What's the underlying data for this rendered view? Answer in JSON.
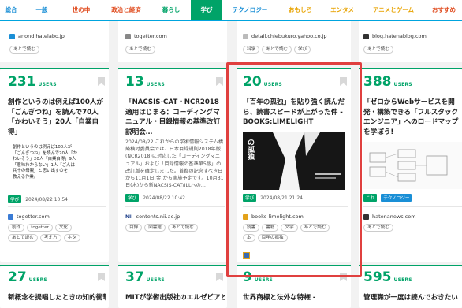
{
  "nav": [
    {
      "label": "総合",
      "color": "#1a8fd6"
    },
    {
      "label": "一般",
      "color": "#1a8fd6"
    },
    {
      "label": "世の中",
      "color": "#e04c1f"
    },
    {
      "label": "政治と経済",
      "color": "#e04c1f"
    },
    {
      "label": "暮らし",
      "color": "#00a368"
    },
    {
      "label": "学び",
      "color": "#ffffff",
      "active": true
    },
    {
      "label": "テクノロジー",
      "color": "#1a8fd6"
    },
    {
      "label": "おもしろ",
      "color": "#e8a300"
    },
    {
      "label": "エンタメ",
      "color": "#e8a300"
    },
    {
      "label": "アニメとゲーム",
      "color": "#e8a300"
    },
    {
      "label": "おすすめ",
      "color": "#e04c1f"
    }
  ],
  "top_strip": [
    {
      "source": "anond.hatelabo.jp",
      "tags": [
        "あとで読む"
      ]
    },
    {
      "source": "togetter.com",
      "tags": [
        "あとで読む"
      ]
    },
    {
      "source": "detail.chiebukuro.yahoo.co.jp",
      "tags": [
        "科学",
        "あとで読む",
        "学び"
      ]
    },
    {
      "source": "blog.hatenablog.com",
      "tags": [
        "あとで読む"
      ]
    }
  ],
  "cards": [
    {
      "users": "231",
      "users_label": "USERS",
      "title": "創作というのは例えば100人が「ごんぎつね」を読んで70人「かわいそう」20人「自業自得」",
      "thumb_lines": [
        "創作というのは例えば100人が",
        "「ごんぎつね」を読んで70人「か",
        "わいそう」20人「自業自得」9人",
        "「意味わからない」1人「ごんは",
        "兵十の母親」と思い出すのを",
        "教える作業。"
      ],
      "category": "学び",
      "date": "2024/08/22 10:54",
      "source": "togetter.com",
      "tags": [
        "創作",
        "togetter",
        "文化",
        "あとで読む",
        "考え方",
        "ネタ"
      ]
    },
    {
      "users": "13",
      "users_label": "USERS",
      "title": "「NACSIS-CAT・NCR2018適用はじまる：コーディングマニュアル・目録情報の基準改訂説明会…",
      "desc": "2024/08/22 これからの学術情報システム構築検討委員会では、日本目録規則2018年版(NCR2018)に対応した「コーディングマニュアル」および「目録情報の基準第5版」の改訂版を確定しました。首都の記念すべき日から11月1日(金)から実施予定です。10月31日(木)から新NACSIS-CAT/ILLへの…",
      "category": "学び",
      "date": "2024/08/22 10:42",
      "source": "contents.nii.ac.jp",
      "tags": [
        "目録",
        "図書館",
        "あとで読む"
      ]
    },
    {
      "users": "20",
      "users_label": "USERS",
      "title": "「百年の孤独」を貼り強く読んだら、読書スピードが上がった件 - BOOKS:LIMELIGHT",
      "thumb_text": "の孤独",
      "category": "学び",
      "date": "2024/08/21 21:24",
      "source": "books-limelight.com",
      "tags": [
        "読書",
        "書籍",
        "文学",
        "あとで読む",
        "本",
        "百年の孤独"
      ]
    },
    {
      "users": "388",
      "users_label": "USERS",
      "title": "「ゼロからWebサービスを開発・構築できる「フルスタックエンジニア」へのロードマップを学ぼう!",
      "category": "これ",
      "category2": "テクノロジー",
      "source": "hatenanews.com",
      "tags": [
        "あとで読む"
      ]
    }
  ],
  "bottom_cards": [
    {
      "users": "27",
      "users_label": "USERS",
      "title": "新概念を提唱したときの知的衝撃"
    },
    {
      "users": "37",
      "users_label": "USERS",
      "title": "MITが学術出版社のエルゼビアと"
    },
    {
      "users": "9",
      "users_label": "USERS",
      "title": "世界商標と法外な特権 -"
    },
    {
      "users": "595",
      "users_label": "USERS",
      "title": "管理職が一度は読んでおきたい"
    }
  ]
}
